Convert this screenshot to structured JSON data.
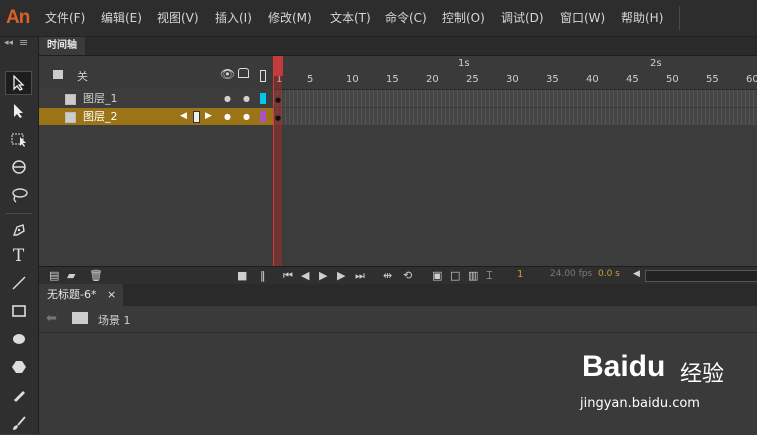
{
  "app": {
    "logo": "An"
  },
  "menu": [
    "文件(F)",
    "编辑(E)",
    "视图(V)",
    "插入(I)",
    "修改(M)",
    "文本(T)",
    "命令(C)",
    "控制(O)",
    "调试(D)",
    "窗口(W)",
    "帮助(H)"
  ],
  "toolbar": {
    "collapse_label": "◂◂"
  },
  "timeline": {
    "tab_label": "时间轴",
    "header_label": "关",
    "ruler": {
      "seconds": [
        "1s",
        "2s"
      ],
      "frames": [
        "1",
        "5",
        "10",
        "15",
        "20",
        "25",
        "30",
        "35",
        "40",
        "45",
        "50",
        "55",
        "60"
      ]
    },
    "layers": [
      {
        "name": "图层_1",
        "color": "#00c8e6",
        "selected": false
      },
      {
        "name": "图层_2",
        "color": "#b04fc8",
        "selected": true
      }
    ],
    "status": {
      "frame": "1",
      "fps": "24.00 fps",
      "time": "0.0 s"
    }
  },
  "document": {
    "tab_label": "无标题-6*",
    "close": "×",
    "scene_label": "场景 1"
  },
  "watermark": {
    "brand": "Baidu",
    "brand_cn": "经验",
    "url": "jingyan.baidu.com"
  },
  "colors": {
    "accent": "#d8602a",
    "selected_row": "#9a7416",
    "playhead": "#c23a3a"
  }
}
